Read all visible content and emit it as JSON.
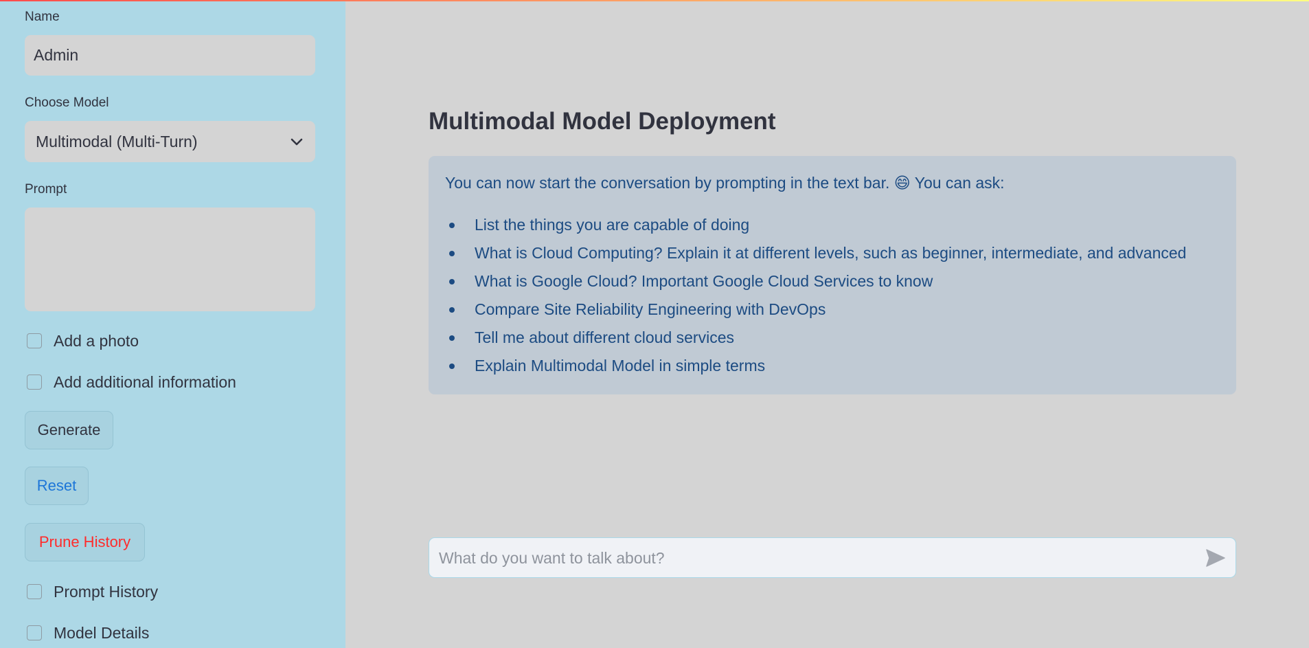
{
  "sidebar": {
    "name_label": "Name",
    "name_value": "Admin",
    "model_label": "Choose Model",
    "model_selected": "Multimodal (Multi-Turn)",
    "prompt_label": "Prompt",
    "prompt_value": "",
    "add_photo_label": "Add a photo",
    "add_info_label": "Add additional information",
    "generate_label": "Generate",
    "reset_label": "Reset",
    "prune_label": "Prune History",
    "prompt_history_label": "Prompt History",
    "model_details_label": "Model Details"
  },
  "main": {
    "title": "Multimodal Model Deployment",
    "intro": "You can now start the conversation by prompting in the text bar. 😄 You can ask:",
    "suggestions": [
      "List the things you are capable of doing",
      "What is Cloud Computing? Explain it at different levels, such as beginner, intermediate, and advanced",
      "What is Google Cloud? Important Google Cloud Services to know",
      "Compare Site Reliability Engineering with DevOps",
      "Tell me about different cloud services",
      "Explain Multimodal Model in simple terms"
    ]
  },
  "chat": {
    "placeholder": "What do you want to talk about?"
  },
  "icons": {
    "select": "chevron-down-icon",
    "send": "send-icon",
    "resize": "resize-grip-icon"
  },
  "colors": {
    "sidebar_bg": "#add8e6",
    "main_bg": "#d4d4d4",
    "info_bg": "#c0cad4",
    "info_text": "#1c4b82",
    "reset_text": "#1c75d8",
    "prune_text": "#ff2b2b"
  }
}
